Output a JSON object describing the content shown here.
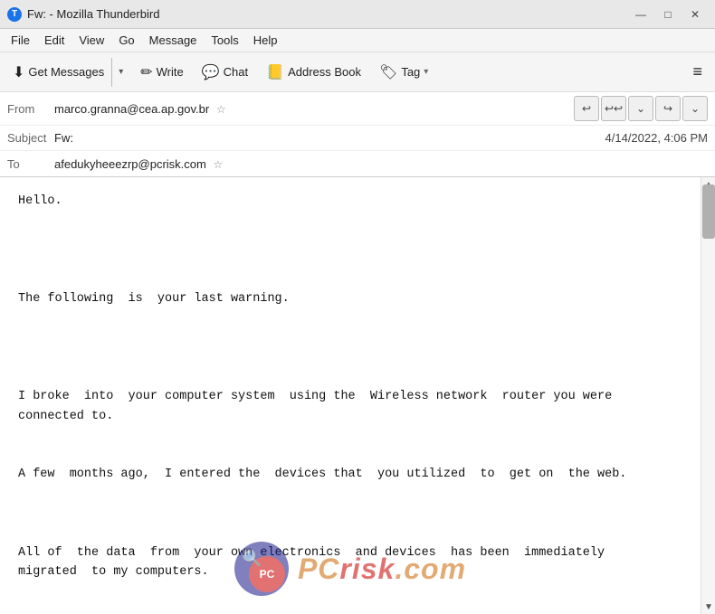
{
  "titlebar": {
    "title": "Fw: - Mozilla Thunderbird",
    "icon": "T",
    "minimize": "—",
    "maximize": "□",
    "close": "✕"
  },
  "menubar": {
    "items": [
      "File",
      "Edit",
      "View",
      "Go",
      "Message",
      "Tools",
      "Help"
    ]
  },
  "toolbar": {
    "get_messages": "Get Messages",
    "write": "Write",
    "chat": "Chat",
    "address_book": "Address Book",
    "tag": "Tag",
    "hamburger": "≡"
  },
  "header": {
    "from_label": "From",
    "from_value": "marco.granna@cea.ap.gov.br",
    "subject_label": "Subject",
    "subject_value": "Fw:",
    "date_value": "4/14/2022, 4:06 PM",
    "to_label": "To",
    "to_value": "afedukyheeezrp@pcrisk.com"
  },
  "nav_buttons": {
    "reply": "↩",
    "reply_all": "↩↩",
    "dropdown": "⌄",
    "forward": "↪",
    "more": "⌄"
  },
  "email": {
    "body": "Hello.\n\n\n\n\nThe following  is  your last warning.\n\n\n\n\nI broke  into  your computer system  using the  Wireless network  router you were\nconnected to.\n\n\nA few  months ago,  I entered the  devices that  you utilized  to  get on  the web.\n\n\n\nAll of  the data  from  your own electronics  and devices  has been  immediately\nmigrated  to my computers."
  },
  "watermark": {
    "text_prefix": "PC",
    "text_suffix": "risk",
    "domain": ".com"
  }
}
